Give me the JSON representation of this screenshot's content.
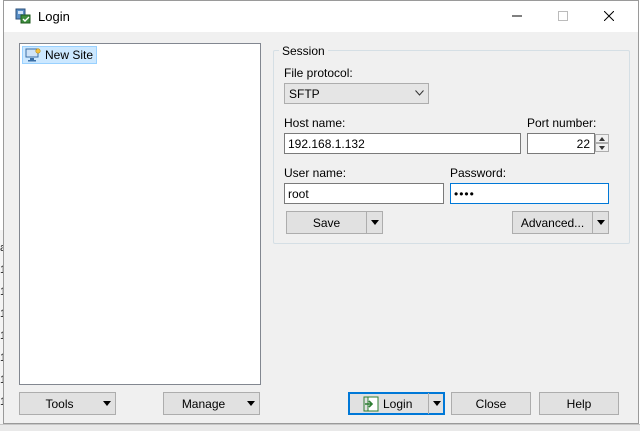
{
  "window": {
    "title": "Login"
  },
  "tree": {
    "items": [
      {
        "label": "New Site"
      }
    ]
  },
  "session": {
    "group_label": "Session",
    "file_protocol_label": "File protocol:",
    "file_protocol_value": "SFTP",
    "host_name_label": "Host name:",
    "host_name_value": "192.168.1.132",
    "port_label": "Port number:",
    "port_value": "22",
    "user_name_label": "User name:",
    "user_name_value": "root",
    "password_label": "Password:",
    "password_value": "••••",
    "save_label": "Save",
    "advanced_label": "Advanced..."
  },
  "bottom": {
    "tools_label": "Tools",
    "manage_label": "Manage",
    "login_label": "Login",
    "close_label": "Close",
    "help_label": "Help"
  },
  "background": {
    "chars": [
      "a",
      "1",
      "1",
      "1",
      "1",
      "1",
      "1",
      "1"
    ]
  },
  "colors": {
    "selection": "#cce8ff",
    "focus": "#0078d7",
    "dialog_bg": "#f0f0f0"
  }
}
